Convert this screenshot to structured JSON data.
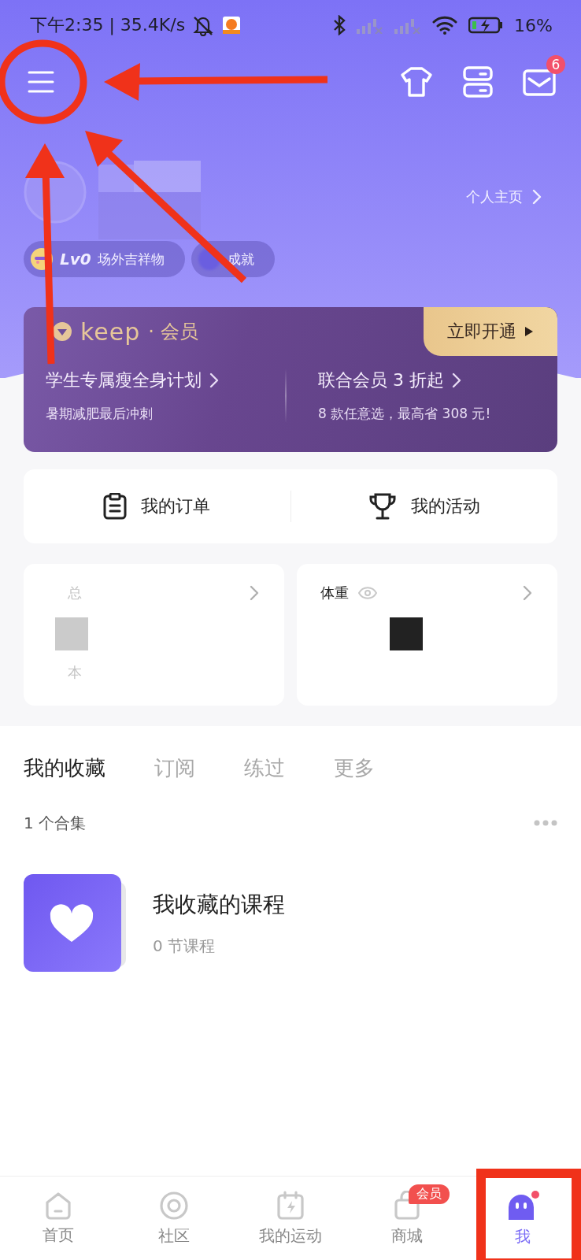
{
  "status_bar": {
    "time_speed": "下午2:35 | 35.4K/s",
    "battery": "16%"
  },
  "header": {
    "mail_badge": "6",
    "profile_link": "个人主页",
    "badges": [
      {
        "tier": "Lv0",
        "label": "场外吉祥物"
      },
      {
        "label": "成就"
      }
    ]
  },
  "membership": {
    "logo": "keep",
    "logo_suffix": "· 会员",
    "cta": "立即开通",
    "offers": [
      {
        "title": "学生专属瘦全身计划",
        "subtitle": "暑期减肥最后冲刺"
      },
      {
        "title": "联合会员 3 折起",
        "subtitle": "8 款任意选，最高省 308 元!"
      }
    ]
  },
  "shortcuts": [
    {
      "kind": "orders",
      "label": "我的订单"
    },
    {
      "kind": "activities",
      "label": "我的活动"
    }
  ],
  "stats": [
    {
      "kind": "sport",
      "title": "总",
      "footer": "本"
    },
    {
      "kind": "weight",
      "title": "体重"
    }
  ],
  "tabs": [
    {
      "label": "我的收藏",
      "selected": true
    },
    {
      "label": "订阅",
      "selected": false
    },
    {
      "label": "练过",
      "selected": false
    },
    {
      "label": "更多",
      "selected": false
    }
  ],
  "collection_count": "1 个合集",
  "collections": [
    {
      "title": "我收藏的课程",
      "subtitle": "0 节课程"
    }
  ],
  "nav": [
    {
      "kind": "home",
      "label": "首页",
      "selected": false
    },
    {
      "kind": "community",
      "label": "社区",
      "selected": false
    },
    {
      "kind": "sport",
      "label": "我的运动",
      "selected": false
    },
    {
      "kind": "mall",
      "label": "商城",
      "selected": false,
      "badge": "会员"
    },
    {
      "kind": "me",
      "label": "我",
      "selected": true
    }
  ]
}
